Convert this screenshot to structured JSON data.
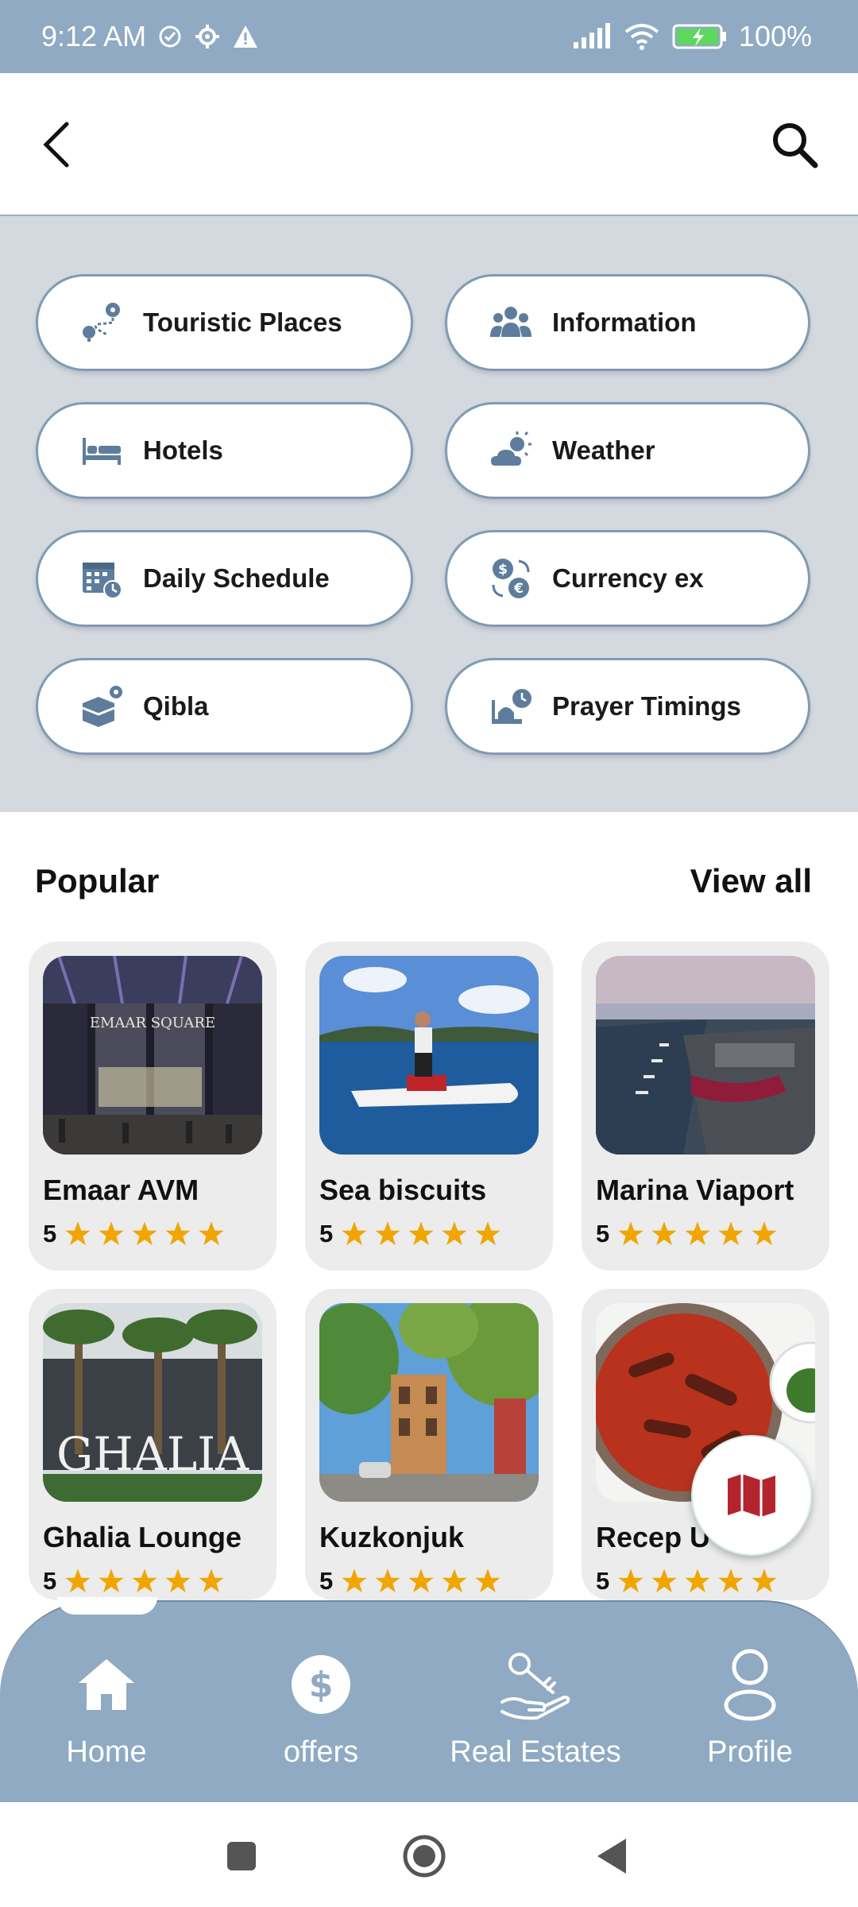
{
  "status_bar": {
    "time": "9:12 AM",
    "battery": "100%"
  },
  "categories": [
    {
      "label": "Touristic Places",
      "icon": "route-pin-icon"
    },
    {
      "label": "Information",
      "icon": "people-group-icon"
    },
    {
      "label": "Hotels",
      "icon": "bed-icon"
    },
    {
      "label": "Weather",
      "icon": "cloud-sun-icon"
    },
    {
      "label": "Daily Schedule",
      "icon": "calendar-clock-icon"
    },
    {
      "label": "Currency ex",
      "icon": "currency-exchange-icon"
    },
    {
      "label": "Qibla",
      "icon": "kaaba-pin-icon"
    },
    {
      "label": "Prayer Timings",
      "icon": "mosque-clock-icon"
    }
  ],
  "popular": {
    "title": "Popular",
    "view_all": "View all",
    "items": [
      {
        "name": "Emaar AVM",
        "rating": "5"
      },
      {
        "name": "Sea biscuits",
        "rating": "5"
      },
      {
        "name": "Marina Viaport",
        "rating": "5"
      },
      {
        "name": "Ghalia Lounge",
        "rating": "5"
      },
      {
        "name": "Kuzkonjuk",
        "rating": "5"
      },
      {
        "name": "Recep U",
        "rating": "5"
      }
    ]
  },
  "photo_signs": {
    "emaar": "EMAAR SQUARE",
    "ghalia": "GHALIA"
  },
  "bottom_nav": [
    {
      "label": "Home",
      "icon": "home-icon"
    },
    {
      "label": "offers",
      "icon": "dollar-coin-icon"
    },
    {
      "label": "Real Estates",
      "icon": "hand-key-icon"
    },
    {
      "label": "Profile",
      "icon": "user-icon"
    }
  ],
  "colors": {
    "accent": "#8faac2",
    "star": "#f0a500",
    "icon": "#5e7d9c",
    "map": "#b3242c"
  }
}
